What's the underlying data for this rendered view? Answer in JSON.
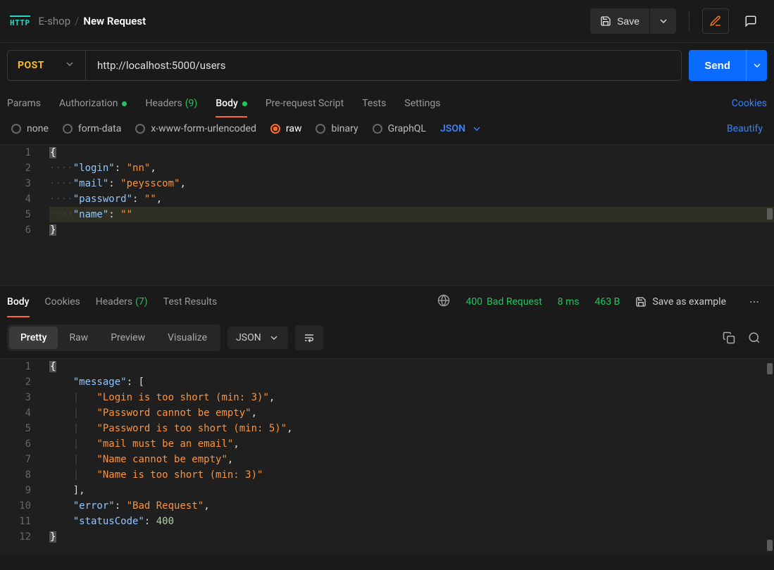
{
  "header": {
    "protocol_badge": "HTTP",
    "breadcrumb_parent": "E-shop",
    "breadcrumb_current": "New Request",
    "save_label": "Save"
  },
  "request": {
    "method": "POST",
    "url": "http://localhost:5000/users",
    "send_label": "Send"
  },
  "tabs": {
    "params": "Params",
    "authorization": "Authorization",
    "headers": "Headers",
    "headers_count": "(9)",
    "body": "Body",
    "pre_request": "Pre-request Script",
    "tests": "Tests",
    "settings": "Settings",
    "cookies_link": "Cookies"
  },
  "body_types": {
    "none": "none",
    "form_data": "form-data",
    "x_www": "x-www-form-urlencoded",
    "raw": "raw",
    "binary": "binary",
    "graphql": "GraphQL",
    "lang": "JSON",
    "beautify": "Beautify"
  },
  "request_body": {
    "lines": [
      "1",
      "2",
      "3",
      "4",
      "5",
      "6"
    ],
    "k_login": "\"login\"",
    "v_login": "\"nn\"",
    "k_mail": "\"mail\"",
    "v_mail": "\"peysscom\"",
    "k_password": "\"password\"",
    "v_password": "\"\"",
    "k_name": "\"name\"",
    "v_name": "\"\""
  },
  "response_meta": {
    "tabs": {
      "body": "Body",
      "cookies": "Cookies",
      "headers": "Headers",
      "headers_count": "(7)",
      "test_results": "Test Results"
    },
    "status_code": "400",
    "status_text": "Bad Request",
    "time": "8 ms",
    "size": "463 B",
    "save_example": "Save as example"
  },
  "response_view": {
    "pretty": "Pretty",
    "raw": "Raw",
    "preview": "Preview",
    "visualize": "Visualize",
    "format": "JSON"
  },
  "response_body": {
    "lines": [
      "1",
      "2",
      "3",
      "4",
      "5",
      "6",
      "7",
      "8",
      "9",
      "10",
      "11",
      "12"
    ],
    "message_key": "\"message\"",
    "messages": [
      "\"Login is too short (min: 3)\"",
      "\"Password cannot be empty\"",
      "\"Password is too short (min: 5)\"",
      "\"mail must be an email\"",
      "\"Name cannot be empty\"",
      "\"Name is too short (min: 3)\""
    ],
    "error_key": "\"error\"",
    "error_val": "\"Bad Request\"",
    "status_key": "\"statusCode\"",
    "status_val": "400"
  }
}
